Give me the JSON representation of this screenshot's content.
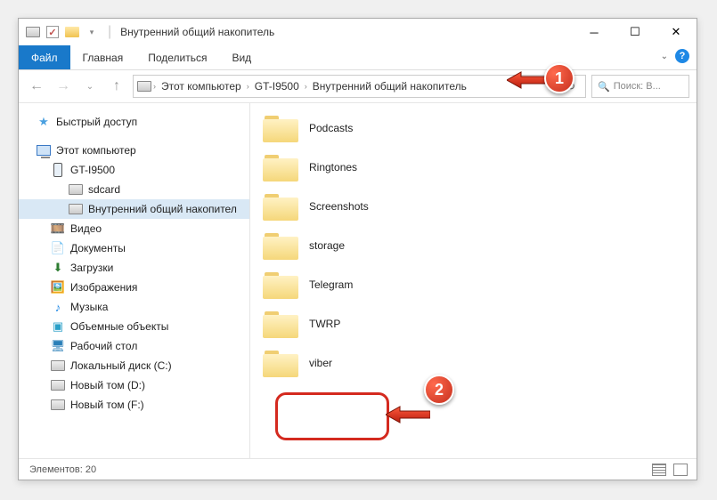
{
  "window": {
    "title": "Внутренний общий накопитель"
  },
  "ribbon": {
    "file": "Файл",
    "home": "Главная",
    "share": "Поделиться",
    "view": "Вид"
  },
  "breadcrumbs": {
    "pc": "Этот компьютер",
    "device": "GT-I9500",
    "storage": "Внутренний общий накопитель"
  },
  "search": {
    "placeholder": "Поиск: В..."
  },
  "sidebar": {
    "quick": "Быстрый доступ",
    "thispc": "Этот компьютер",
    "device": "GT-I9500",
    "sdcard": "sdcard",
    "internal": "Внутренний общий накопител",
    "videos": "Видео",
    "documents": "Документы",
    "downloads": "Загрузки",
    "pictures": "Изображения",
    "music": "Музыка",
    "objects3d": "Объемные объекты",
    "desktop": "Рабочий стол",
    "localdisk": "Локальный диск (C:)",
    "newvol_d": "Новый том (D:)",
    "newvol_f": "Новый том (F:)"
  },
  "folders": [
    {
      "name": "Podcasts"
    },
    {
      "name": "Ringtones"
    },
    {
      "name": "Screenshots"
    },
    {
      "name": "storage"
    },
    {
      "name": "Telegram"
    },
    {
      "name": "TWRP"
    },
    {
      "name": "viber"
    }
  ],
  "status": {
    "items_label": "Элементов:",
    "items_count": "20"
  },
  "badges": {
    "one": "1",
    "two": "2"
  }
}
